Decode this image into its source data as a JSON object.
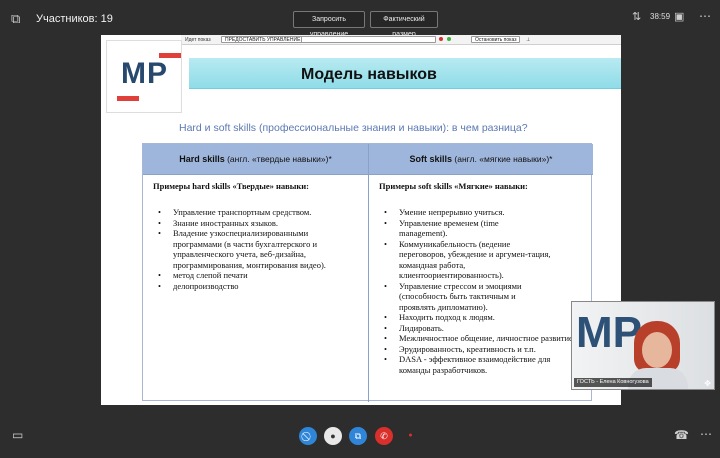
{
  "top": {
    "participants": "Участников: 19",
    "request_control": "Запросить управление",
    "actual_size": "Фактический размер",
    "clock": "38:59"
  },
  "share_bar": {
    "showing": "Идет показ",
    "grant_control": "ПРЕДОСТАВИТЬ УПРАВЛЕНИЕ",
    "stop_showing": "Остановить показ"
  },
  "slide": {
    "logo": "МР",
    "title": "Модель навыков",
    "subtitle": "Hard и soft skills (профессиональные знания и навыки): в чем разница?",
    "hard_header_bold": "Hard skills",
    "hard_header_rest": " (англ. «твердые навыки»)*",
    "soft_header_bold": "Soft skills",
    "soft_header_rest": " (англ. «мягкие навыки»)*",
    "hard_subhead": "Примеры hard skills «Твердые» навыки:",
    "soft_subhead": "Примеры soft skills «Мягкие» навыки:",
    "hard_items": [
      "Управление транспортным средством.",
      "Знание иностранных языков.",
      "Владение узкоспециализированными программами (в части бухгалтерского и управленческого учета, веб-дизайна, программирования, монтирования видео).",
      "метод слепой печати",
      "делопроизводство"
    ],
    "soft_items": [
      "Умение непрерывно учиться.",
      "Управление временем (time management).",
      "Коммуникабельность (ведение переговоров, убеждение и аргумен-тация, командная работа, клиентоориентированность).",
      "Управление стрессом и эмоциями (способность быть тактичным и проявлять дипломатию).",
      "Находить подход к людям.",
      "Лидировать.",
      "Межличностное общение, личностное развитие.",
      "Эрудированность, креативность и т.п.",
      "DASA - эффективное взаимодействие для команды разработчиков."
    ]
  },
  "webcam": {
    "logo": "МР",
    "label": "ГОСТЬ - Елена Ковногузова"
  },
  "colors": {
    "title_band": "#8fdce8",
    "table_header": "#9fb6dc",
    "logo_red": "#e0403a",
    "end_call": "#d9302c",
    "camera_off": "#2f86d8"
  }
}
